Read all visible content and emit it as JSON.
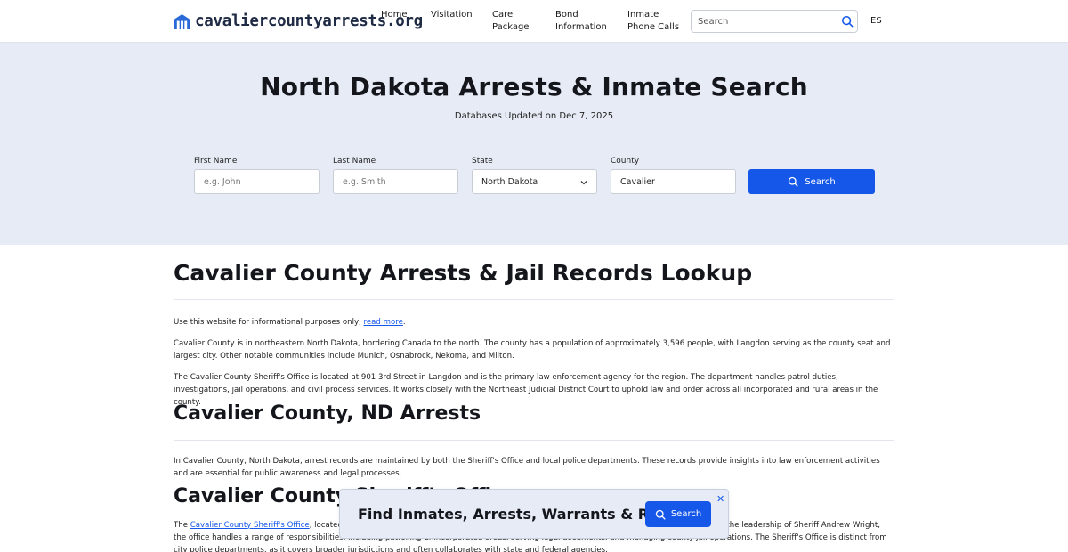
{
  "header": {
    "logo_text": "cavaliercountyarrests.org",
    "nav": {
      "home": "Home",
      "visitation": "Visitation",
      "care_package": "Care\nPackage",
      "bond_information": "Bond\nInformation",
      "inmate_phone_calls": "Inmate\nPhone Calls"
    },
    "search_placeholder": "Search",
    "lang": "ES"
  },
  "hero": {
    "title": "North Dakota Arrests & Inmate Search",
    "updated": "Databases Updated on Dec 7, 2025",
    "form": {
      "first_name_label": "First Name",
      "first_name_placeholder": "e.g. John",
      "last_name_label": "Last Name",
      "last_name_placeholder": "e.g. Smith",
      "state_label": "State",
      "state_value": "North Dakota",
      "county_label": "County",
      "county_value": "Cavalier",
      "search_button": "Search"
    }
  },
  "content": {
    "h1": "Cavalier County Arrests & Jail Records Lookup",
    "disclaimer_prefix": "Use this website for informational purposes only, ",
    "disclaimer_link": "read more",
    "disclaimer_suffix": ".",
    "p1": "Cavalier County is in northeastern North Dakota, bordering Canada to the north. The county has a population of approximately 3,596 people, with Langdon serving as the county seat and largest city. Other notable communities include Munich, Osnabrock, Nekoma, and Milton.",
    "p2": "The Cavalier County Sheriff's Office is located at 901 3rd Street in Langdon and is the primary law enforcement agency for the region. The department handles patrol duties, investigations, jail operations, and civil process services. It works closely with the Northeast Judicial District Court to uphold law and order across all incorporated and rural areas in the county.",
    "h2_arrests": "Cavalier County, ND Arrests",
    "p3": "In Cavalier County, North Dakota, arrest records are maintained by both the Sheriff's Office and local police departments. These records provide insights into law enforcement activities and are essential for public awareness and legal processes.",
    "h2_sheriff": "Cavalier County Sheriff's Office",
    "p4_prefix": "The ",
    "p4_link": "Cavalier County Sheriff's Office",
    "p4_suffix": ", located at 901 3rd Street in Langdon, serves as the primary law enforcement agency for the county. Under the leadership of Sheriff Andrew Wright, the office handles a range of responsibilities, including patrolling unincorporated areas, serving legal documents, and managing county jail operations. The Sheriff's Office is distinct from city police departments, as it covers broader jurisdictions and often collaborates with state and federal agencies."
  },
  "banner": {
    "title": "Find Inmates, Arrests, Warrants & Records",
    "button": "Search",
    "close": "✕"
  },
  "colors": {
    "accent": "#1557e8",
    "hero_bg": "#e6ebf5"
  }
}
